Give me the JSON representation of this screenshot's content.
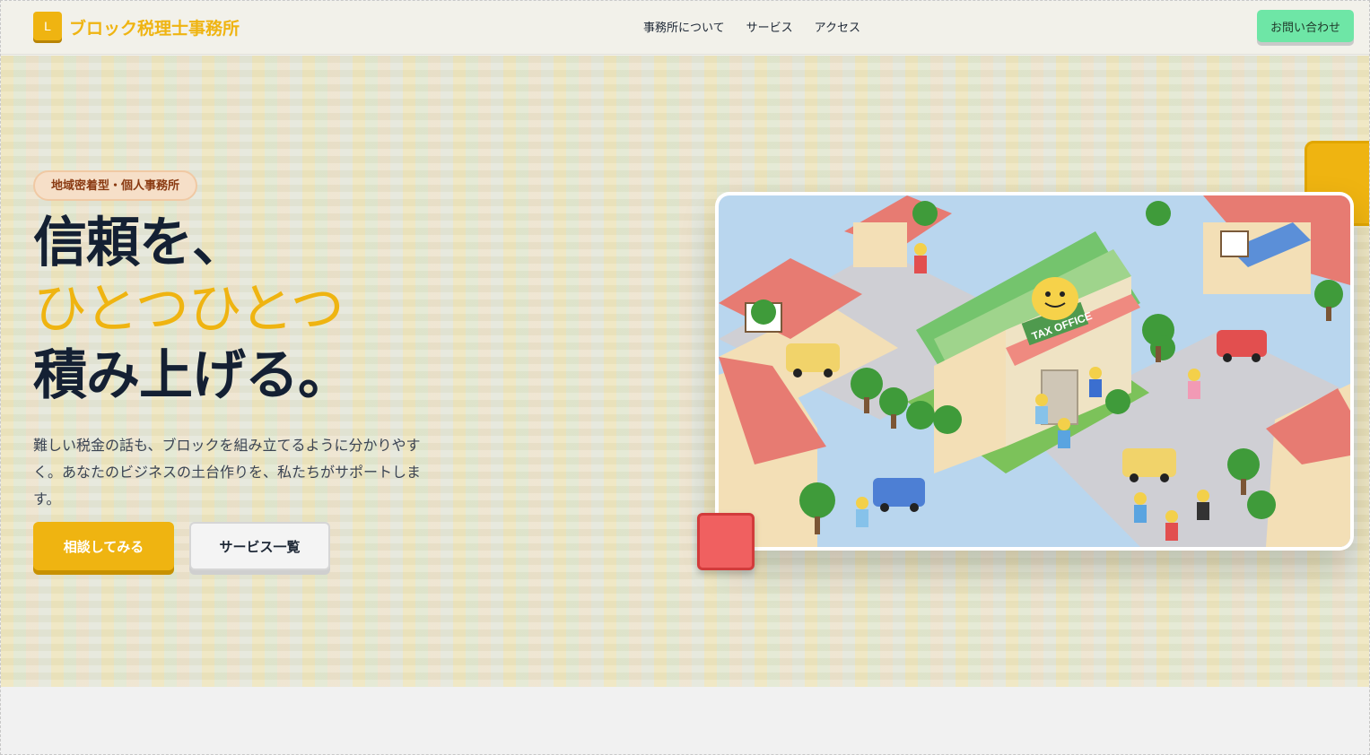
{
  "header": {
    "logo_letter": "L",
    "site_name": "ブロック税理士事務所",
    "nav": [
      "事務所について",
      "サービス",
      "アクセス"
    ],
    "contact_label": "お問い合わせ"
  },
  "hero": {
    "badge": "地域密着型・個人事務所",
    "headline_line1": "信頼を、",
    "headline_line2": "ひとつひとつ",
    "headline_line3": "積み上げる。",
    "lead": "難しい税金の話も、ブロックを組み立てるように分かりやすく。あなたのビジネスの土台作りを、私たちがサポートします。",
    "primary_button": "相談してみる",
    "secondary_button": "サービス一覧",
    "image_sign": "TAX OFFICE"
  },
  "colors": {
    "brand_yellow": "#efb411",
    "contact_green": "#6ee6a6",
    "text_dark": "#142033",
    "accent_red": "#f06060"
  }
}
